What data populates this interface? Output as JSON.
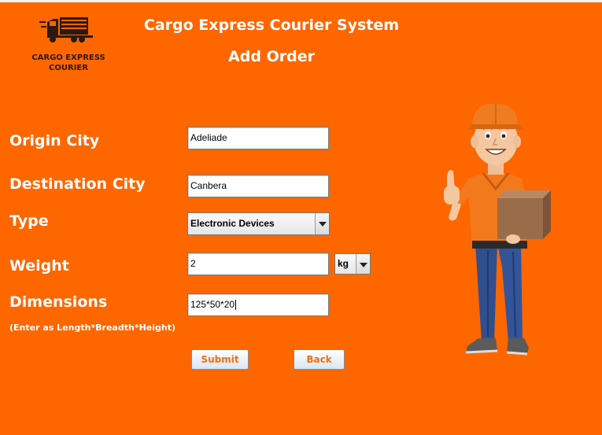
{
  "logo": {
    "line1": "CARGO EXPRESS",
    "line2": "COURIER"
  },
  "header": {
    "title": "Cargo Express Courier System",
    "subtitle": "Add Order"
  },
  "form": {
    "origin_label": "Origin City",
    "origin_value": "Adeliade",
    "destination_label": "Destination City",
    "destination_value": "Canbera",
    "type_label": "Type",
    "type_value": "Electronic Devices",
    "weight_label": "Weight",
    "weight_value": "2",
    "weight_unit": "kg",
    "dimensions_label": "Dimensions",
    "dimensions_hint": "(Enter as Length*Breadth*Height)",
    "dimensions_value": "125*50*20"
  },
  "buttons": {
    "submit": "Submit",
    "back": "Back"
  },
  "colors": {
    "background": "#fe6600",
    "button_text": "#f56f10"
  },
  "icons": {
    "logo": "truck-icon",
    "illustration": "delivery-man-illustration"
  }
}
